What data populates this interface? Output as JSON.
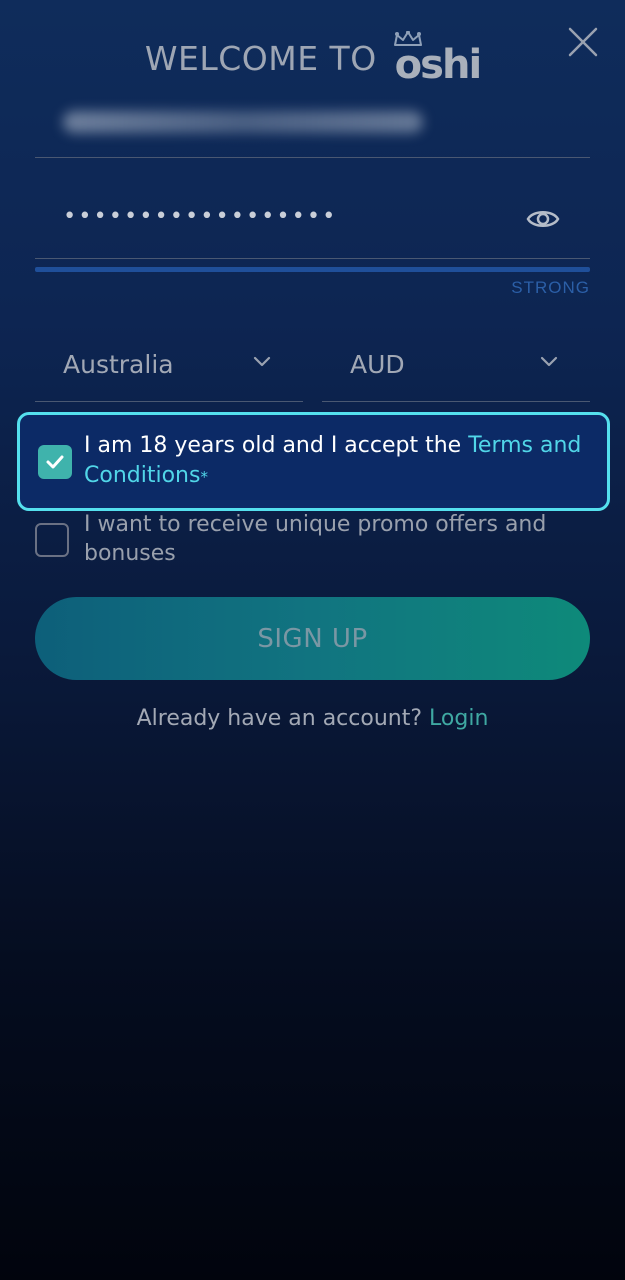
{
  "header": {
    "welcome_text": "WELCOME TO",
    "logo_text": "oshi"
  },
  "form": {
    "email_value": "",
    "password_dots": "••••••••••••••••••",
    "password_strength": "STRONG",
    "country": "Australia",
    "currency": "AUD",
    "terms": {
      "prefix": "I am 18 years old and I accept the ",
      "link": "Terms and Conditions",
      "asterisk": "*",
      "checked": true
    },
    "promo": {
      "text": "I want to receive unique promo offers and bonuses",
      "checked": false
    },
    "signup_label": "SIGN UP",
    "login_prompt": "Already have an account? ",
    "login_link": "Login"
  },
  "icons": {
    "close": "close-icon",
    "eye": "eye-icon",
    "chevron": "chevron-down-icon",
    "check": "checkmark-icon",
    "crown": "crown-icon"
  },
  "colors": {
    "accent": "#51d6e8",
    "checkbox": "#3fb3ac",
    "login_link": "#3fa8a2",
    "strength_bar": "#1f4f9a"
  }
}
